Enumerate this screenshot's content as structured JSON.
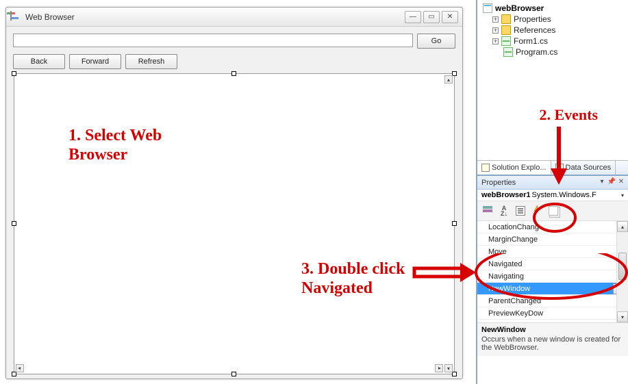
{
  "form": {
    "title": "Web Browser",
    "go_label": "Go",
    "back_label": "Back",
    "forward_label": "Forward",
    "refresh_label": "Refresh",
    "url_value": ""
  },
  "solution": {
    "project": "webBrowser",
    "nodes": {
      "properties": "Properties",
      "references": "References",
      "form1": "Form1.cs",
      "program": "Program.cs"
    }
  },
  "tabs": {
    "solution_explorer": "Solution Explo...",
    "data_sources": "Data Sources"
  },
  "properties": {
    "panel_title": "Properties",
    "component_name": "webBrowser1",
    "component_type": "System.Windows.F",
    "events": [
      "LocationChang",
      "MarginChange",
      "Move",
      "Navigated",
      "Navigating",
      "NewWindow",
      "ParentChanged",
      "PreviewKeyDow"
    ],
    "selected_event": "NewWindow",
    "desc_name": "NewWindow",
    "desc_text": "Occurs when a new window is created for the WebBrowser."
  },
  "annotations": {
    "step1": "1. Select Web Browser",
    "step2": "2. Events",
    "step3": "3. Double click Navigated"
  }
}
